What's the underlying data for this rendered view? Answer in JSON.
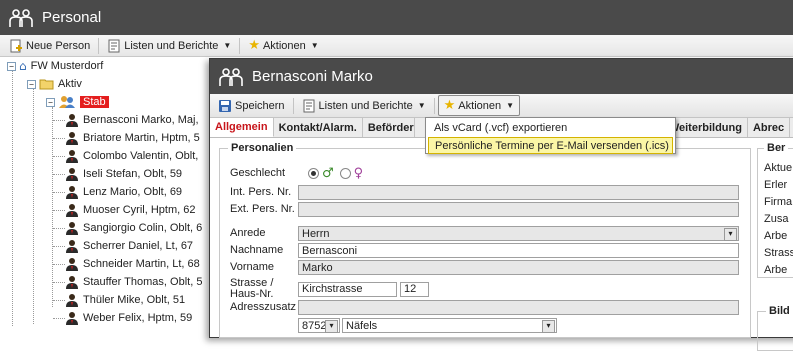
{
  "main": {
    "title": "Personal",
    "toolbar": {
      "new_person": "Neue Person",
      "lists_reports": "Listen und Berichte",
      "actions": "Aktionen"
    }
  },
  "tree": {
    "root": "FW Musterdorf",
    "active": "Aktiv",
    "stab": "Stab",
    "people": [
      "Bernasconi Marko, Maj,",
      "Briatore Martin, Hptm, 5",
      "Colombo Valentin, Oblt,",
      "Iseli Stefan, Oblt, 59",
      "Lenz Mario, Oblt, 69",
      "Muoser Cyril, Hptm, 62",
      "Sangiorgio Colin, Oblt, 6",
      "Scherrer Daniel, Lt, 67",
      "Schneider Martin, Lt, 68",
      "Stauffer Thomas, Oblt, 5",
      "Thüler Mike, Oblt, 51",
      "Weber Felix, Hptm, 59"
    ]
  },
  "dialog": {
    "title": "Bernasconi Marko",
    "toolbar": {
      "save": "Speichern",
      "lists_reports": "Listen und Berichte",
      "actions": "Aktionen"
    },
    "tabs": [
      "Allgemein",
      "Kontakt/Alarm.",
      "Beförder",
      "Weiterbildung",
      "Abrec"
    ],
    "personalien": {
      "legend": "Personalien",
      "gender_label": "Geschlecht",
      "int_pers_nr_label": "Int. Pers. Nr.",
      "int_pers_nr": "",
      "ext_pers_nr_label": "Ext. Pers. Nr.",
      "ext_pers_nr": "",
      "anrede_label": "Anrede",
      "anrede": "Herrn",
      "nachname_label": "Nachname",
      "nachname": "Bernasconi",
      "vorname_label": "Vorname",
      "vorname": "Marko",
      "strasse_label": "Strasse / Haus-Nr.",
      "strasse": "Kirchstrasse",
      "hausnr": "12",
      "adresszusatz_label": "Adresszusatz",
      "adresszusatz": "",
      "plz": "8752",
      "ort": "Näfels"
    },
    "right_panel": {
      "legend": "Ber",
      "items": [
        "Aktue",
        "Erler",
        "Firma",
        "Zusa",
        "Arbe",
        "Strass",
        "Arbe"
      ]
    },
    "right_panel2": {
      "legend": "Bild"
    }
  },
  "actions_menu": {
    "items": [
      "Als vCard (.vcf) exportieren",
      "Persönliche Termine per E-Mail versenden (.ics)"
    ]
  }
}
